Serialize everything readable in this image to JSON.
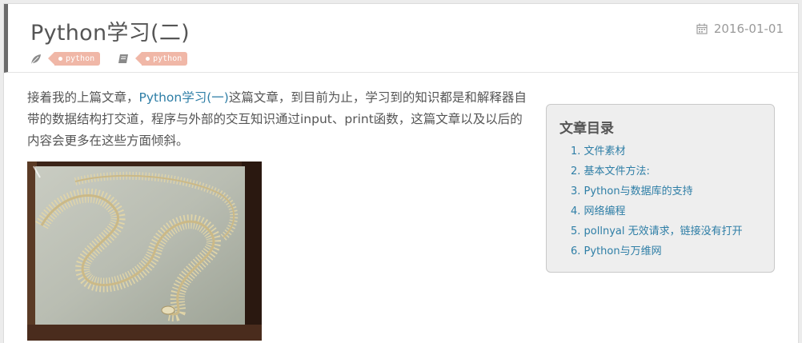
{
  "post": {
    "title": "Python学习(二)",
    "date": "2016-01-01",
    "date_icon": "calendar-icon",
    "category_icon": "leaf-icon",
    "tag_icon": "book-icon",
    "category_tag": "python",
    "tag": "python"
  },
  "intro": {
    "text_before": "接着我的上篇文章，",
    "link_text": "Python学习(一)",
    "text_after": "这篇文章，到目前为止，学习到的知识都是和解释器自带的数据结构打交道，程序与外部的交互知识通过input、print函数，这篇文章以及以后的内容会更多在这些方面倾斜。"
  },
  "image": {
    "subject": "snake skeleton in display case"
  },
  "toc": {
    "title": "文章目录",
    "items": [
      "1. 文件素材",
      "2. 基本文件方法:",
      "3. Python与数据库的支持",
      "4. 网络编程",
      "5. pollnyal 无效请求，链接没有打开",
      "6. Python与万维网"
    ]
  },
  "colors": {
    "accent_link": "#2e7ea6",
    "tag_bg": "#f0b7a7",
    "header_bar": "#6b6b6b",
    "toc_bg": "#eeeeee"
  }
}
